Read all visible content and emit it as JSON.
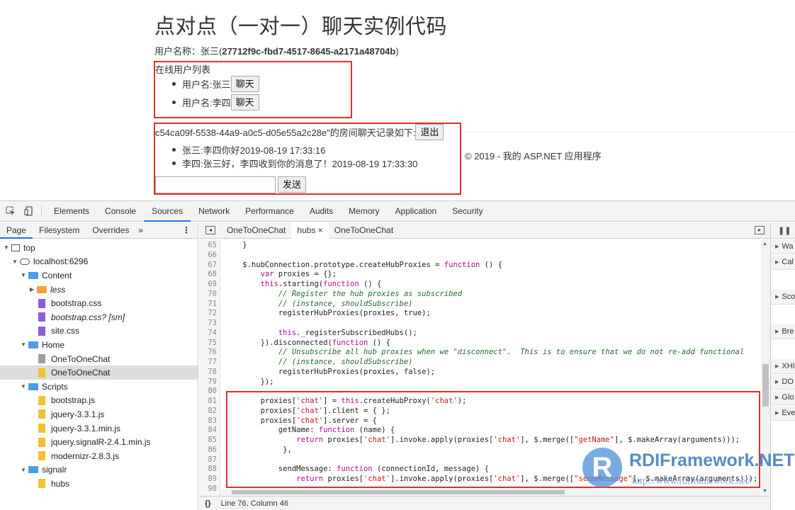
{
  "page": {
    "title": "点对点（一对一）聊天实例代码",
    "user_prefix": "用户名称：张三(",
    "user_id": "27712f9c-fbd7-4517-8645-a2171a48704b",
    "user_suffix": ")",
    "online_title": "在线用户列表",
    "online_users": [
      {
        "label": "用户名:张三",
        "button": "聊天"
      },
      {
        "label": "用户名:李四",
        "button": "聊天"
      }
    ],
    "room_title": "c54ca09f-5538-44a9-a0c5-d05e55a2c28e\"的房间聊天记录如下:",
    "exit_button": "退出",
    "messages": [
      "张三:李四你好2019-08-19 17:33:16",
      "李四:张三好，李四收到你的消息了！2019-08-19 17:33:30"
    ],
    "send_placeholder": "",
    "send_button": "发送",
    "footer": "© 2019 - 我的 ASP.NET 应用程序"
  },
  "devtools": {
    "tabs": [
      "Elements",
      "Console",
      "Sources",
      "Network",
      "Performance",
      "Audits",
      "Memory",
      "Application",
      "Security"
    ],
    "active_tab": "Sources",
    "navigator_tabs": [
      "Page",
      "Filesystem",
      "Overrides"
    ],
    "navigator_more": "»",
    "tree": [
      {
        "label": "top",
        "kind": "frame",
        "depth": 0,
        "open": true
      },
      {
        "label": "localhost:6296",
        "kind": "cloud",
        "depth": 1,
        "open": true
      },
      {
        "label": "Content",
        "kind": "folder",
        "depth": 2,
        "open": true
      },
      {
        "label": "less",
        "kind": "folder-orange",
        "depth": 3,
        "open": false,
        "italic": true
      },
      {
        "label": "bootstrap.css",
        "kind": "file-purple",
        "depth": 3
      },
      {
        "label": "bootstrap.css? [sm]",
        "kind": "file-purple",
        "depth": 3,
        "italic": true
      },
      {
        "label": "site.css",
        "kind": "file-purple",
        "depth": 3
      },
      {
        "label": "Home",
        "kind": "folder",
        "depth": 2,
        "open": true
      },
      {
        "label": "OneToOneChat",
        "kind": "file-gray",
        "depth": 3
      },
      {
        "label": "OneToOneChat",
        "kind": "file-yellow",
        "depth": 3,
        "selected": true
      },
      {
        "label": "Scripts",
        "kind": "folder",
        "depth": 2,
        "open": true
      },
      {
        "label": "bootstrap.js",
        "kind": "file-yellow",
        "depth": 3
      },
      {
        "label": "jquery-3.3.1.js",
        "kind": "file-yellow",
        "depth": 3
      },
      {
        "label": "jquery-3.3.1.min.js",
        "kind": "file-yellow",
        "depth": 3
      },
      {
        "label": "jquery.signalR-2.4.1.min.js",
        "kind": "file-yellow",
        "depth": 3
      },
      {
        "label": "modernizr-2.8.3.js",
        "kind": "file-yellow",
        "depth": 3
      },
      {
        "label": "signalr",
        "kind": "folder",
        "depth": 2,
        "open": true
      },
      {
        "label": "hubs",
        "kind": "file-yellow",
        "depth": 3
      }
    ],
    "editor_tabs": [
      {
        "label": "OneToOneChat",
        "active": false
      },
      {
        "label": "hubs",
        "active": true,
        "close": "×"
      },
      {
        "label": "OneToOneChat",
        "active": false
      }
    ],
    "code": [
      {
        "n": "65",
        "t": "    }"
      },
      {
        "n": "66",
        "t": ""
      },
      {
        "n": "67",
        "t": "    $.hubConnection.prototype.createHubProxies = function () {"
      },
      {
        "n": "68",
        "t": "        var proxies = {};"
      },
      {
        "n": "69",
        "t": "        this.starting(function () {"
      },
      {
        "n": "70",
        "t": "            // Register the hub proxies as subscribed",
        "c": true
      },
      {
        "n": "71",
        "t": "            // (instance, shouldSubscribe)",
        "c": true
      },
      {
        "n": "72",
        "t": "            registerHubProxies(proxies, true);"
      },
      {
        "n": "73",
        "t": ""
      },
      {
        "n": "74",
        "t": "            this._registerSubscribedHubs();"
      },
      {
        "n": "75",
        "t": "        }).disconnected(function () {"
      },
      {
        "n": "76",
        "t": "            // Unsubscribe all hub proxies when we \"disconnect\".  This is to ensure that we do not re-add functional",
        "c": true
      },
      {
        "n": "77",
        "t": "            // (instance, shouldSubscribe)",
        "c": true
      },
      {
        "n": "78",
        "t": "            registerHubProxies(proxies, false);"
      },
      {
        "n": "79",
        "t": "        });"
      },
      {
        "n": "80",
        "t": ""
      },
      {
        "n": "81",
        "t": "        proxies['chat'] = this.createHubProxy('chat');"
      },
      {
        "n": "82",
        "t": "        proxies['chat'].client = { };"
      },
      {
        "n": "83",
        "t": "        proxies['chat'].server = {"
      },
      {
        "n": "84",
        "t": "            getName: function (name) {"
      },
      {
        "n": "85",
        "t": "                return proxies['chat'].invoke.apply(proxies['chat'], $.merge([\"getName\"], $.makeArray(arguments)));"
      },
      {
        "n": "86",
        "t": "             },"
      },
      {
        "n": "87",
        "t": ""
      },
      {
        "n": "88",
        "t": "            sendMessage: function (connectionId, message) {"
      },
      {
        "n": "89",
        "t": "                return proxies['chat'].invoke.apply(proxies['chat'], $.merge([\"sendMessage\"], $.makeArray(arguments)));"
      },
      {
        "n": "90",
        "t": ""
      }
    ],
    "status": "Line 76, Column 46",
    "status_braces": "{}",
    "debugger_sections": [
      "Wa",
      "Cal",
      "Sco",
      "Bre",
      "XHI",
      "DO",
      "Glo",
      "Eve"
    ],
    "pause_icon": "❚❚"
  },
  "watermark": {
    "logo_letter": "R",
    "title": "RDIFramework.NET",
    "url": "http://www.rdiframework.net/"
  }
}
